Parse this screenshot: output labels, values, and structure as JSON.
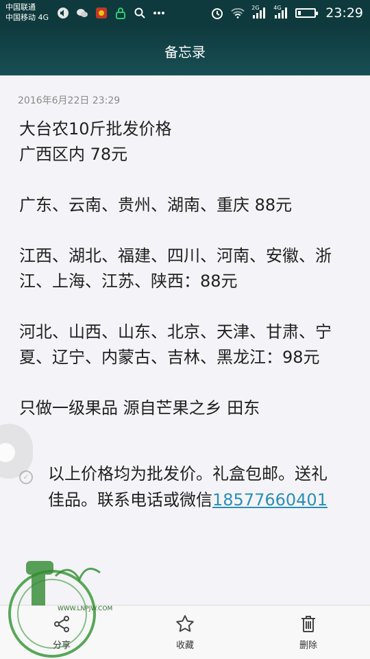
{
  "status_bar": {
    "carrier_1": "中国联通",
    "carrier_2": "中国移动 4G",
    "network_1": "2G",
    "network_2": "4G",
    "time": "23:29"
  },
  "title_bar": {
    "title": "备忘录"
  },
  "note": {
    "timestamp": "2016年6月22日 23:29",
    "paragraphs": [
      "大台农10斤批发价格\n广西区内 78元",
      "广东、云南、贵州、湖南、重庆 88元",
      "江西、湖北、福建、四川、河南、安徽、浙江、上海、江苏、陕西：88元",
      "河北、山西、山东、北京、天津、甘肃、宁夏、辽宁、内蒙古、吉林、黑龙江：98元",
      "只做一级果品 源自芒果之乡 田东"
    ],
    "checklist_item": {
      "text": "以上价格均为批发价。礼盒包邮。送礼佳品。联系电话或微信",
      "phone": "18577660401"
    }
  },
  "bottom_bar": {
    "share_label": "分享",
    "favorite_label": "收藏",
    "delete_label": "删除"
  },
  "watermark": {
    "url": "WWW.LNPJW.COM"
  },
  "colors": {
    "header": "#0f3a3d",
    "link": "#2a8fb8"
  }
}
